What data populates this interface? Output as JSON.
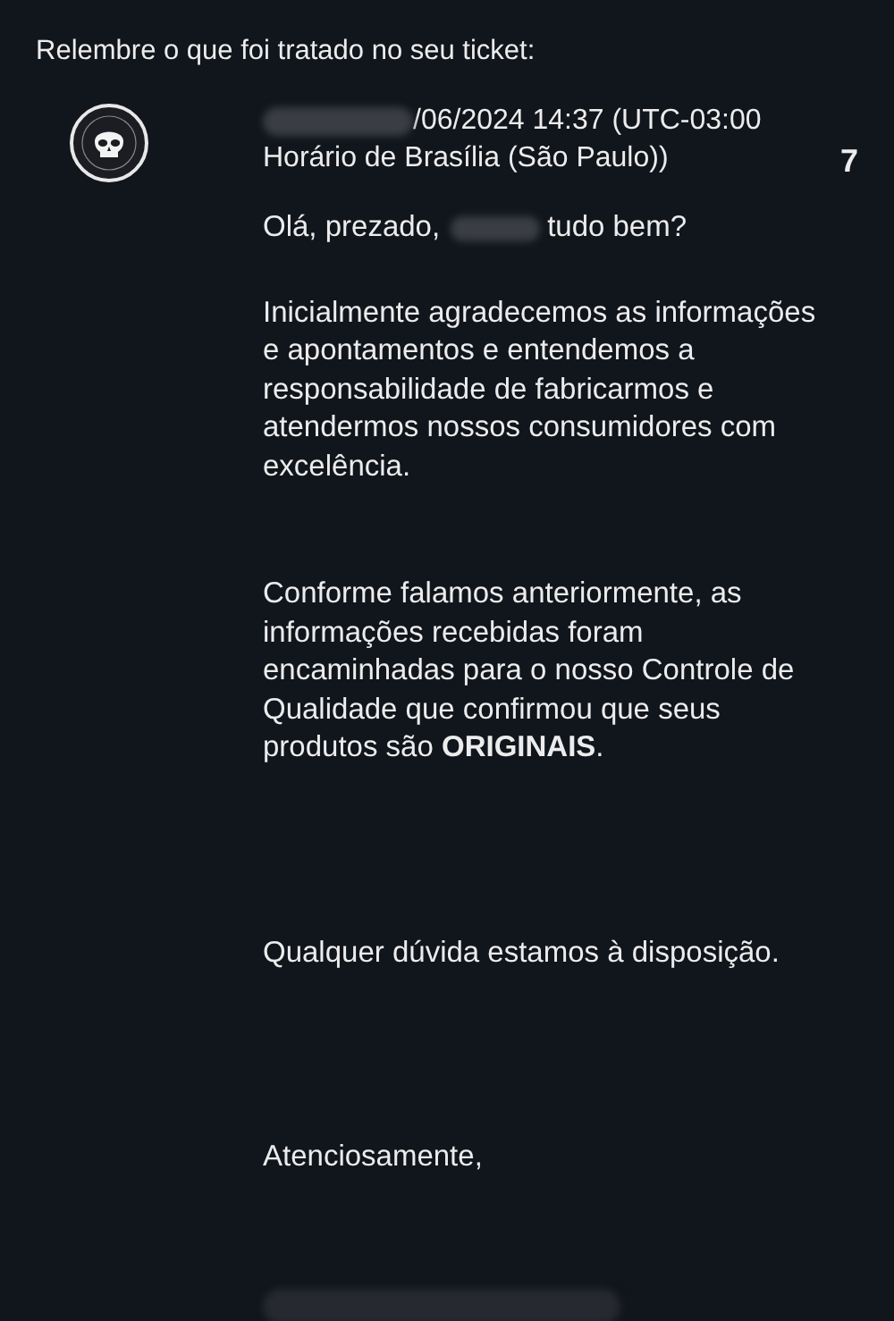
{
  "header": "Relembre o que foi tratado no seu ticket:",
  "message": {
    "date_line": "/06/2024 14:37 (UTC-03:00",
    "timezone_line": "Horário de Brasília (São Paulo))",
    "count": "7",
    "greeting": {
      "before": "Olá, prezado,",
      "after": "tudo bem?"
    },
    "paragraphs": [
      {
        "kind": "body",
        "text": "Inicialmente agradecemos as informações e apontamentos e entendemos a responsabilidade de fabricarmos e atendermos nossos consumidores com excelência."
      },
      {
        "kind": "body",
        "text": "Conforme falamos anteriormente, as informações recebidas foram encaminhadas para o nosso Controle de Qualidade que confirmou que seus produtos  são **ORIGINAIS**."
      },
      {
        "kind": "closing",
        "text": "Qualquer dúvida estamos à disposição."
      },
      {
        "kind": "closing",
        "text": "Atenciosamente,"
      }
    ]
  }
}
